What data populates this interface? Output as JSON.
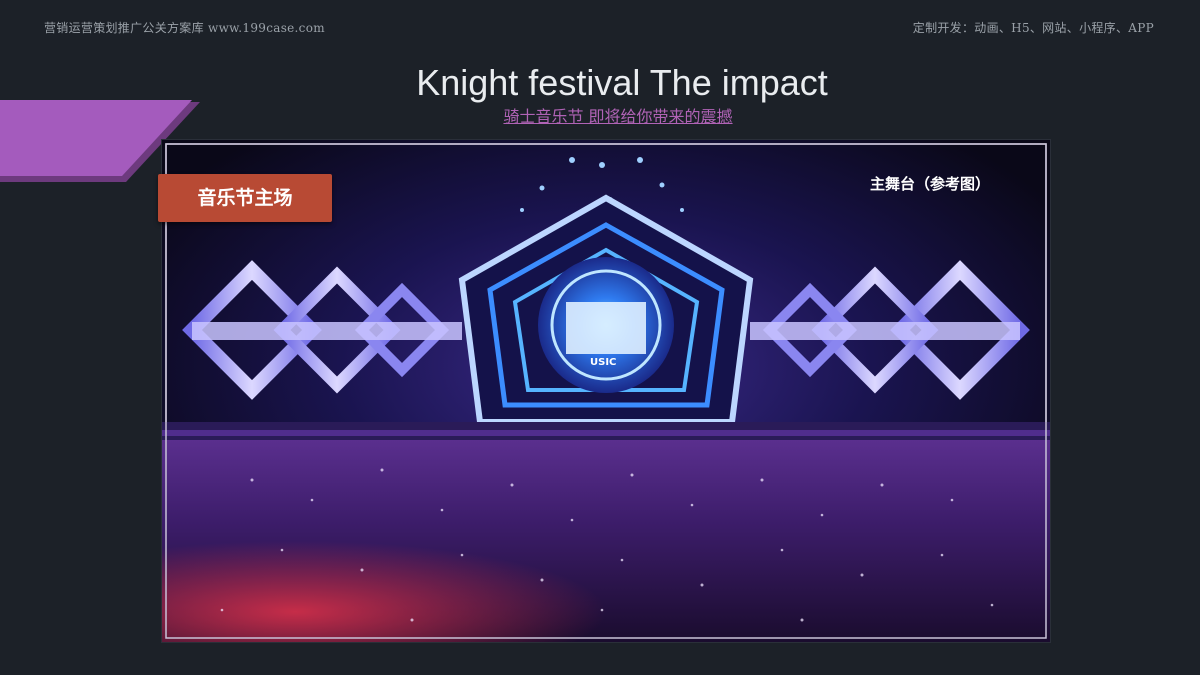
{
  "header": {
    "left_text": "营销运营策划推广公关方案库 www.199case.com",
    "right_text": "定制开发：动画、H5、网站、小程序、APP"
  },
  "slide": {
    "title": "Knight festival The impact",
    "subtitle": "骑士音乐节 即将给你带来的震撼",
    "accent_color": "#9b59b6",
    "badge_color": "#b84a34"
  },
  "photo": {
    "badge_label": "音乐节主场",
    "caption": "主舞台（参考图）",
    "screen_text": "USIC"
  }
}
